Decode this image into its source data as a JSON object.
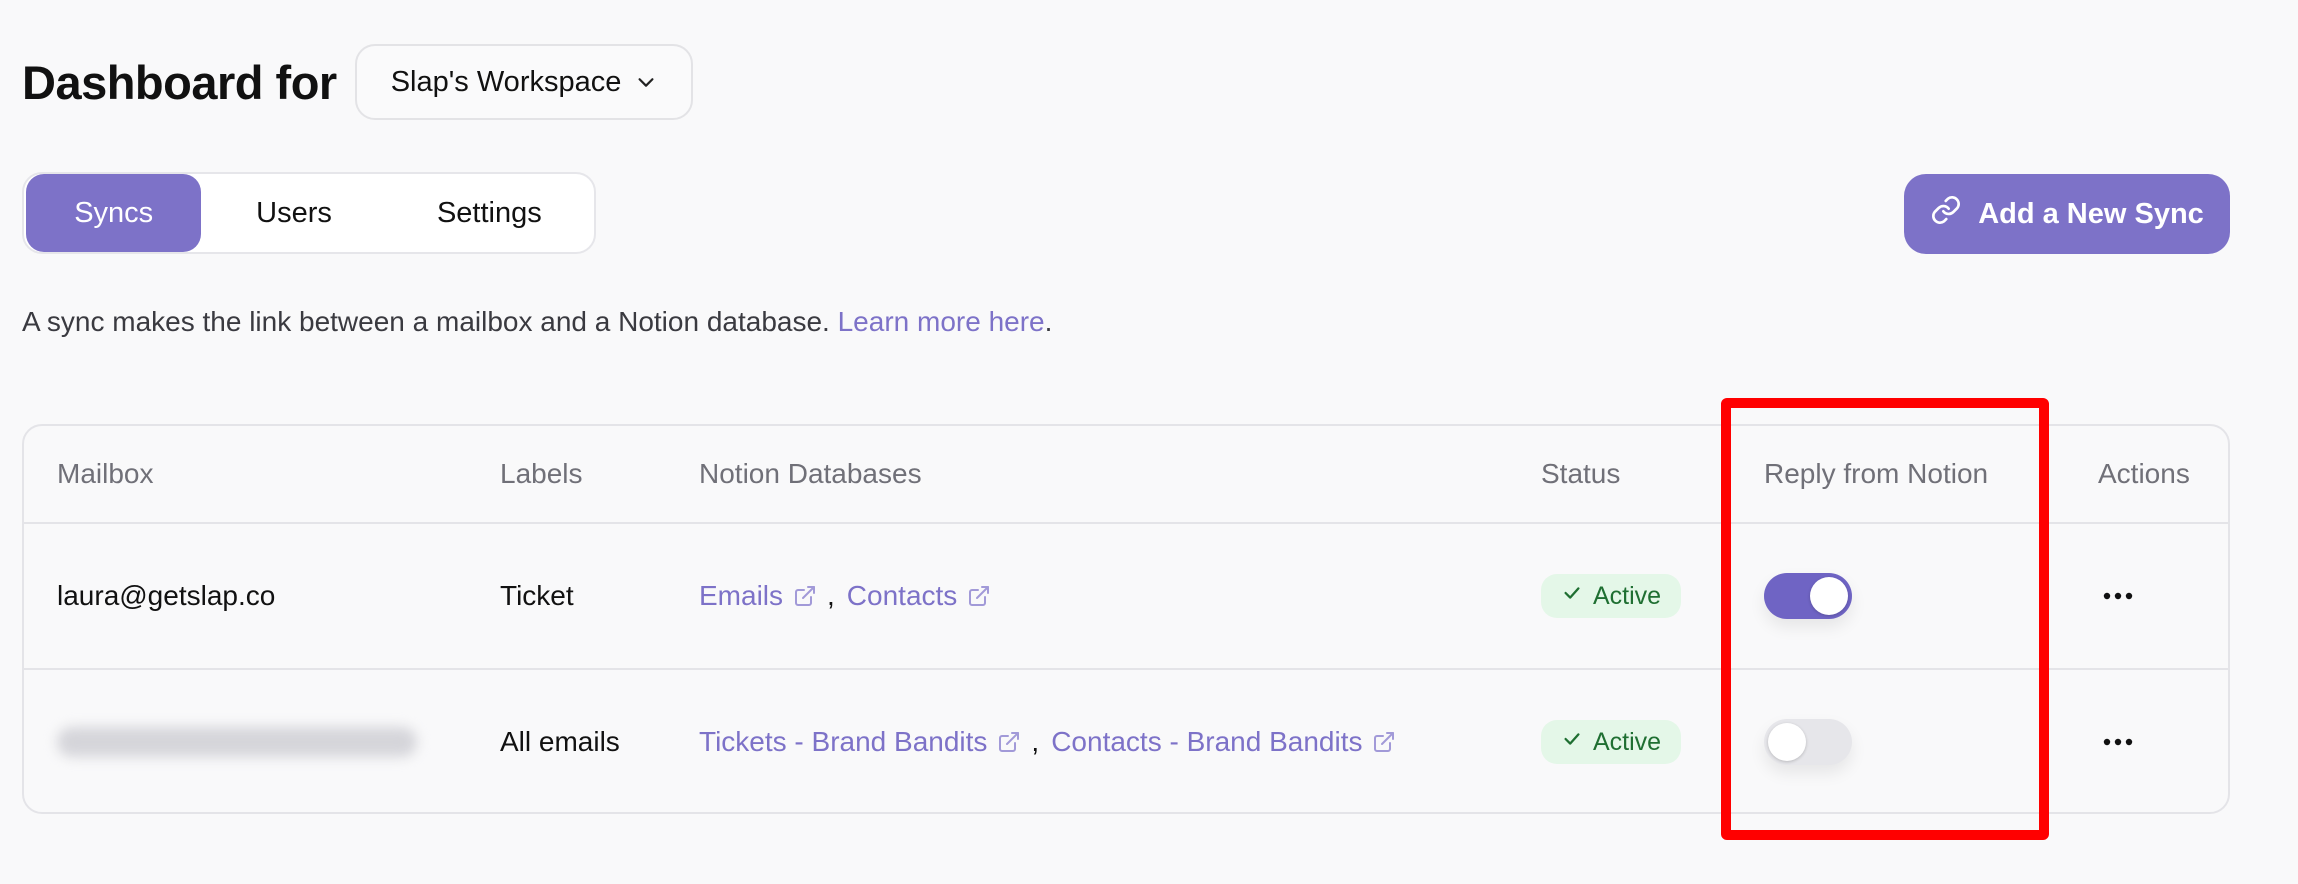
{
  "header": {
    "title": "Dashboard for",
    "workspace": "Slap's Workspace"
  },
  "tabs": [
    {
      "label": "Syncs",
      "active": true
    },
    {
      "label": "Users",
      "active": false
    },
    {
      "label": "Settings",
      "active": false
    }
  ],
  "add_button": {
    "label": "Add a New Sync",
    "icon": "link-icon"
  },
  "description": {
    "text": "A sync makes the link between a mailbox and a Notion database. ",
    "link": "Learn more here",
    "suffix": "."
  },
  "table": {
    "columns": [
      "Mailbox",
      "Labels",
      "Notion Databases",
      "Status",
      "Reply from Notion",
      "Actions"
    ],
    "rows": [
      {
        "mailbox": "laura@getslap.co",
        "mailbox_blurred": false,
        "labels": "Ticket",
        "databases": [
          "Emails",
          "Contacts"
        ],
        "status": "Active",
        "reply_from_notion": true
      },
      {
        "mailbox": "",
        "mailbox_blurred": true,
        "labels": "All emails",
        "databases": [
          "Tickets - Brand Bandits",
          "Contacts - Brand Bandits"
        ],
        "status": "Active",
        "reply_from_notion": false
      }
    ]
  },
  "colors": {
    "accent": "#7d72c8",
    "badge_bg": "#e4f7e8",
    "badge_text": "#1f6f32",
    "highlight": "#ff0000"
  }
}
